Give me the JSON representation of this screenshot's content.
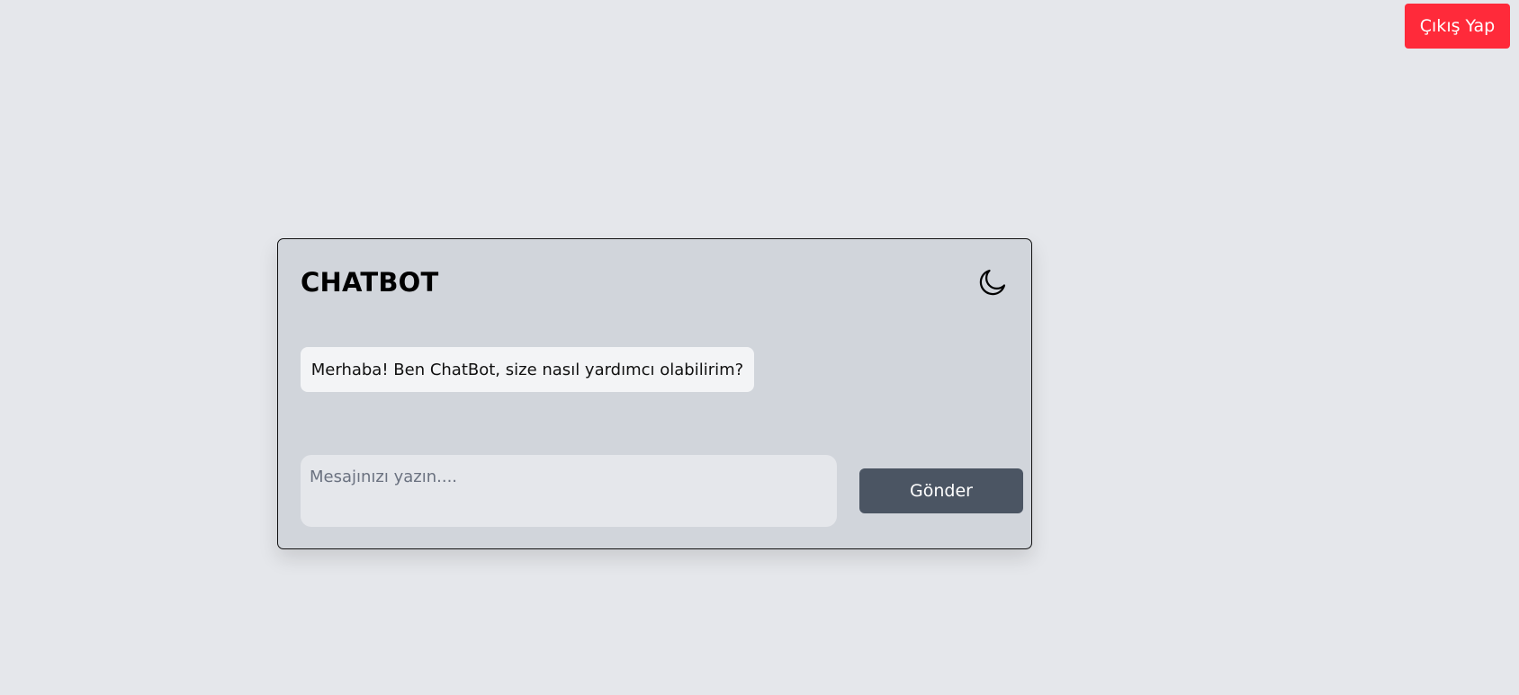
{
  "header": {
    "logout_label": "Çıkış Yap"
  },
  "chat": {
    "title": "CHATBOT",
    "theme_icon": "moon-icon",
    "messages": [
      {
        "sender": "bot",
        "text": "Merhaba! Ben ChatBot, size nasıl yardımcı olabilirim?"
      }
    ],
    "input": {
      "value": "",
      "placeholder": "Mesajınızı yazın...."
    },
    "send_label": "Gönder"
  },
  "colors": {
    "page_background": "#e5e7eb",
    "card_background": "#d1d5db",
    "logout_button": "#ff2a3a",
    "send_button": "#4b5563",
    "bot_bubble": "#f3f4f6"
  }
}
